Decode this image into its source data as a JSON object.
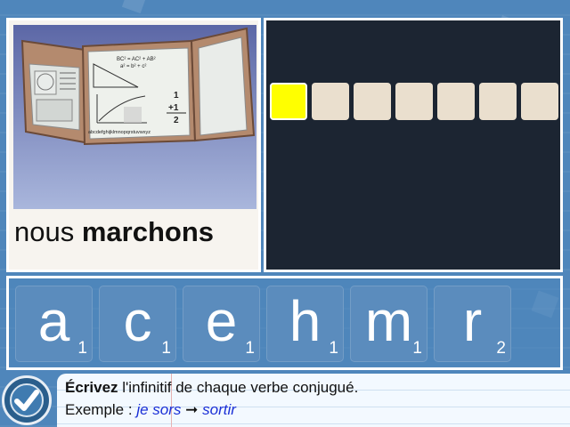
{
  "picture": {
    "icon": "open-briefcase-with-math-notes-image",
    "board_texts": [
      "BC² = AC² + AB²",
      "a² = b² + c²",
      "1",
      "+1",
      "2",
      "abcdefghijklmnopqrstuvwxyz"
    ]
  },
  "word": {
    "prefix": "nous",
    "verb": "marchons"
  },
  "answer": {
    "slot_count": 7,
    "active_index": 0,
    "active_color": "#ffff00",
    "empty_color": "#eadfce"
  },
  "tiles": [
    {
      "letter": "a",
      "count": "1"
    },
    {
      "letter": "c",
      "count": "1"
    },
    {
      "letter": "e",
      "count": "1"
    },
    {
      "letter": "h",
      "count": "1"
    },
    {
      "letter": "m",
      "count": "1"
    },
    {
      "letter": "r",
      "count": "2"
    }
  ],
  "instructions": {
    "bold_word": "Écrivez",
    "text": " l'infinitif de chaque verbe conjugué.",
    "example_label": "Exemple : ",
    "example_from": "je sors",
    "arrow": "➞",
    "example_to": "sortir"
  },
  "check_button": {
    "icon": "checkmark-icon"
  },
  "colors": {
    "background": "#4f86bb",
    "board": "#1c2532",
    "tile": "#5b8cbd",
    "highlight": "#ffff00"
  }
}
